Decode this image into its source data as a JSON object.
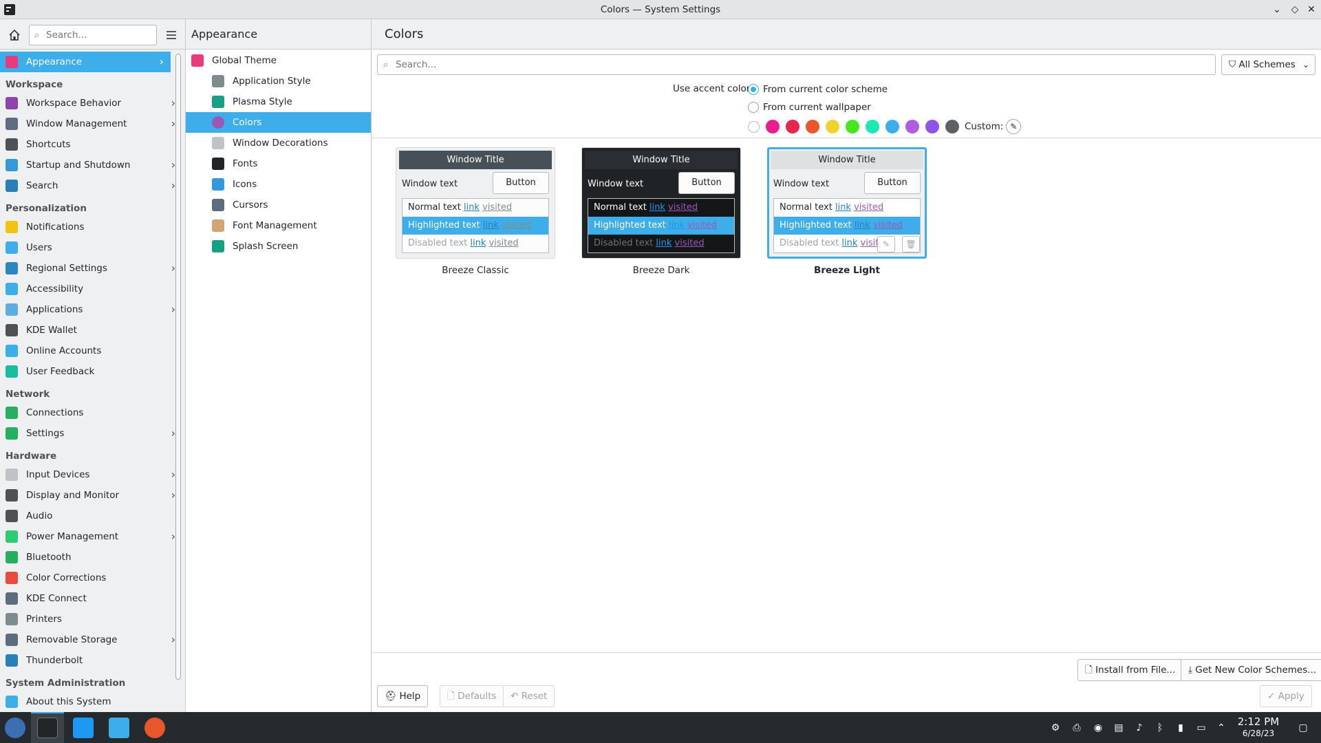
{
  "window": {
    "title": "Colors — System Settings"
  },
  "sidebar": {
    "search_placeholder": "Search...",
    "items": [
      {
        "label": "Appearance",
        "active": true,
        "chevron": true,
        "color": "#e93a7c"
      },
      {
        "section": "Workspace"
      },
      {
        "label": "Workspace Behavior",
        "chevron": true,
        "color": "#8e44ad"
      },
      {
        "label": "Window Management",
        "chevron": true,
        "color": "#5d6d7e"
      },
      {
        "label": "Shortcuts",
        "color": "#4d5256"
      },
      {
        "label": "Startup and Shutdown",
        "chevron": true,
        "color": "#3498db"
      },
      {
        "label": "Search",
        "chevron": true,
        "color": "#2980b9"
      },
      {
        "section": "Personalization"
      },
      {
        "label": "Notifications",
        "color": "#f1c40f"
      },
      {
        "label": "Users",
        "color": "#3daee9"
      },
      {
        "label": "Regional Settings",
        "chevron": true,
        "color": "#2e86c1"
      },
      {
        "label": "Accessibility",
        "color": "#3daee9"
      },
      {
        "label": "Applications",
        "chevron": true,
        "color": "#5dade2"
      },
      {
        "label": "KDE Wallet",
        "color": "#4d5256"
      },
      {
        "label": "Online Accounts",
        "color": "#3daee9"
      },
      {
        "label": "User Feedback",
        "color": "#1abc9c"
      },
      {
        "section": "Network"
      },
      {
        "label": "Connections",
        "color": "#27ae60"
      },
      {
        "label": "Settings",
        "chevron": true,
        "color": "#27ae60"
      },
      {
        "section": "Hardware"
      },
      {
        "label": "Input Devices",
        "chevron": true,
        "color": "#bdc3c7"
      },
      {
        "label": "Display and Monitor",
        "chevron": true,
        "color": "#4d5256"
      },
      {
        "label": "Audio",
        "color": "#4d5256"
      },
      {
        "label": "Power Management",
        "chevron": true,
        "color": "#2ecc71"
      },
      {
        "label": "Bluetooth",
        "color": "#27ae60"
      },
      {
        "label": "Color Corrections",
        "color": "#e74c3c"
      },
      {
        "label": "KDE Connect",
        "color": "#5d6d7e"
      },
      {
        "label": "Printers",
        "color": "#7f8c8d"
      },
      {
        "label": "Removable Storage",
        "chevron": true,
        "color": "#5d6d7e"
      },
      {
        "label": "Thunderbolt",
        "color": "#2980b9"
      },
      {
        "section": "System Administration"
      },
      {
        "label": "About this System",
        "color": "#3daee9"
      }
    ]
  },
  "subpanel": {
    "title": "Appearance",
    "items": [
      {
        "label": "Global Theme",
        "top": true,
        "color": "#e93a7c"
      },
      {
        "label": "Application Style",
        "color": "#7f8c8d"
      },
      {
        "label": "Plasma Style",
        "color": "#16a085"
      },
      {
        "label": "Colors",
        "active": true,
        "color": "#9b59b6"
      },
      {
        "label": "Window Decorations",
        "color": "#bdc3c7"
      },
      {
        "label": "Fonts",
        "color": "#232629"
      },
      {
        "label": "Icons",
        "color": "#3498db"
      },
      {
        "label": "Cursors",
        "color": "#5d6d7e"
      },
      {
        "label": "Font Management",
        "color": "#d4a574"
      },
      {
        "label": "Splash Screen",
        "color": "#16a085"
      }
    ]
  },
  "main": {
    "title": "Colors",
    "search_placeholder": "Search...",
    "filter_label": "All Schemes",
    "accent_label": "Use accent color:",
    "accent_options": [
      "From current color scheme",
      "From current wallpaper"
    ],
    "accent_swatches": [
      "#e91e8c",
      "#e8264d",
      "#e9572b",
      "#f0d22c",
      "#45e81c",
      "#1de8b4",
      "#3daee9",
      "#b05ce0",
      "#8e54e9",
      "#5d6164"
    ],
    "custom_label": "Custom:",
    "schemes": [
      {
        "name": "Breeze Classic",
        "title": "Window Title",
        "window_text": "Window text",
        "button": "Button",
        "normal": "Normal text",
        "highlighted": "Highlighted text",
        "disabled": "Disabled text",
        "link": "link",
        "visited": "visited",
        "colors": {
          "titlebar": "#475057",
          "title_fg": "#ffffff",
          "window_bg": "#eff0f1",
          "fg": "#232629",
          "button_bg": "#fcfcfc",
          "view_bg": "#fcfcfc",
          "highlight": "#3daee9",
          "disabled_fg": "#a0a4a8",
          "link": "#2980b9",
          "visited": "#7f8c8d"
        }
      },
      {
        "name": "Breeze Dark",
        "title": "Window Title",
        "window_text": "Window text",
        "button": "Button",
        "normal": "Normal text",
        "highlighted": "Highlighted text",
        "disabled": "Disabled text",
        "link": "link",
        "visited": "visited",
        "colors": {
          "titlebar": "#2a2e32",
          "title_fg": "#fcfcfc",
          "window_bg": "#202326",
          "fg": "#fcfcfc",
          "button_bg": "#fcfcfc",
          "view_bg": "#141618",
          "highlight": "#3daee9",
          "disabled_fg": "#6e7175",
          "link": "#1d99f3",
          "visited": "#9b59b6"
        }
      },
      {
        "name": "Breeze Light",
        "title": "Window Title",
        "window_text": "Window text",
        "button": "Button",
        "normal": "Normal text",
        "highlighted": "Highlighted text",
        "disabled": "Disabled text",
        "link": "link",
        "visited": "visited",
        "colors": {
          "titlebar": "#dee0e2",
          "title_fg": "#232629",
          "window_bg": "#eff0f1",
          "fg": "#232629",
          "button_bg": "#fcfcfc",
          "view_bg": "#ffffff",
          "highlight": "#3daee9",
          "disabled_fg": "#a0a4a8",
          "link": "#2980b9",
          "visited": "#9b59b6"
        }
      }
    ],
    "buttons": {
      "install": "Install from File...",
      "get_new": "Get New Color Schemes...",
      "help": "Help",
      "defaults": "Defaults",
      "reset": "Reset",
      "apply": "Apply"
    }
  },
  "taskbar": {
    "time": "2:12 PM",
    "date": "6/28/23"
  }
}
